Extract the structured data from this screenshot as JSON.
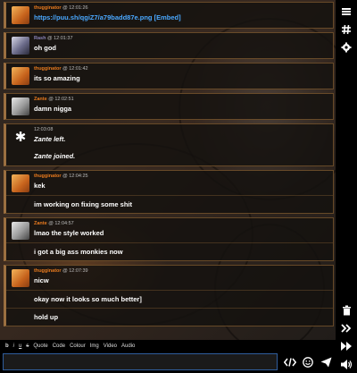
{
  "messages": [
    {
      "user": "thugginator",
      "time": "@ 12:01:26",
      "avatar": "thug",
      "lines": [
        {
          "link": "https://puu.sh/qgiZ7/a79badd87e.png",
          "embed": "[Embed]"
        }
      ]
    },
    {
      "user": "Rash",
      "time": "@ 12:01:37",
      "avatar": "rash",
      "lines": [
        "oh god"
      ]
    },
    {
      "user": "thugginator",
      "time": "@ 12:01:42",
      "avatar": "thug",
      "lines": [
        "its so amazing"
      ]
    },
    {
      "user": "Zante",
      "time": "@ 12:02:51",
      "avatar": "zante",
      "lines": [
        "damn nigga"
      ]
    },
    {
      "user": "",
      "time": "12:03:08",
      "avatar": "sys",
      "lines": [
        "Zante left.",
        "Zante joined."
      ]
    },
    {
      "user": "thugginator",
      "time": "@ 12:04:25",
      "avatar": "thug",
      "lines": [
        "kek",
        "im working on fixing some shit"
      ]
    },
    {
      "user": "Zante",
      "time": "@ 12:04:57",
      "avatar": "zante",
      "lines": [
        "lmao the style worked",
        "i got a big ass monkies now"
      ]
    },
    {
      "user": "thugginator",
      "time": "@ 12:07:39",
      "avatar": "thug",
      "lines": [
        "nicw",
        "okay now it looks so much better]",
        "hold up"
      ]
    }
  ],
  "toolbar": {
    "bold": "b",
    "italic": "i",
    "underline": "u",
    "strike": "s",
    "quote": "Quote",
    "code": "Code",
    "colour": "Colour",
    "img": "Img",
    "video": "Video",
    "audio": "Audio"
  },
  "input": {
    "value": "",
    "placeholder": ""
  },
  "icons": {
    "sidebar_top": [
      "bars-icon",
      "hash-icon",
      "gear-icon"
    ],
    "sidebar_bottom": [
      "trash-icon",
      "chevron-double-right-icon",
      "fast-forward-icon",
      "volume-icon"
    ],
    "input": [
      "code-icon",
      "smiley-icon",
      "send-icon"
    ]
  }
}
